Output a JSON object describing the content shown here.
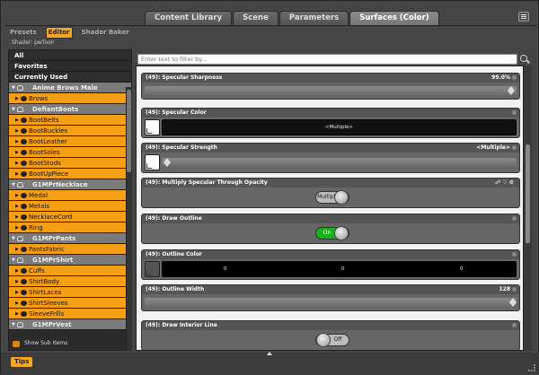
{
  "tabs": [
    "Content Library",
    "Scene",
    "Parameters",
    "Surfaces (Color)"
  ],
  "subtabs": [
    "Presets",
    "Editor",
    "Shader Baker"
  ],
  "shader_label": "Shader: pwToon",
  "left": {
    "top_items": [
      "All",
      "Favorites",
      "Currently Used"
    ],
    "tree": [
      {
        "type": "grp",
        "label": "Anime Brows Male"
      },
      {
        "type": "itm",
        "label": "Brows"
      },
      {
        "type": "grp",
        "label": "DefiantBoots"
      },
      {
        "type": "itm",
        "label": "BootBelts"
      },
      {
        "type": "itm",
        "label": "BootBuckles"
      },
      {
        "type": "itm",
        "label": "BootLeather"
      },
      {
        "type": "itm",
        "label": "BootSoles"
      },
      {
        "type": "itm",
        "label": "BootStuds"
      },
      {
        "type": "itm",
        "label": "BootUpPiece"
      },
      {
        "type": "grp",
        "label": "G1MPrNecklace"
      },
      {
        "type": "itm",
        "label": "Medal"
      },
      {
        "type": "itm",
        "label": "Metals"
      },
      {
        "type": "itm",
        "label": "NecklaceCord"
      },
      {
        "type": "itm",
        "label": "Ring"
      },
      {
        "type": "grp",
        "label": "G1MPrPants"
      },
      {
        "type": "itm",
        "label": "PantsFabric"
      },
      {
        "type": "grp",
        "label": "G1MPrShirt"
      },
      {
        "type": "itm",
        "label": "Cuffs"
      },
      {
        "type": "itm",
        "label": "ShirtBody"
      },
      {
        "type": "itm",
        "label": "ShirtLaces"
      },
      {
        "type": "itm",
        "label": "ShirtSleeves"
      },
      {
        "type": "itm",
        "label": "SleeveFrills"
      },
      {
        "type": "grp",
        "label": "G1MPrVest"
      }
    ],
    "show_sub_items": "Show Sub Items"
  },
  "filter_placeholder": "Enter text to filter by...",
  "props": {
    "spec_sharp": {
      "label": "(49): Specular Sharpness",
      "value": "99.0%",
      "level_percent": 99
    },
    "spec_color": {
      "label": "(49): Specular Color",
      "value": "<Multiple>"
    },
    "spec_strength": {
      "label": "(49): Specular Strength",
      "value": "<Multiple>"
    },
    "mult_spec": {
      "label": "(49): Multiply Specular Through Opacity",
      "toggle": "Multiple"
    },
    "draw_outline": {
      "label": "(49): Draw Outline",
      "toggle": "On"
    },
    "outline_color": {
      "label": "(49): Outline Color",
      "r": "0",
      "g": "0",
      "b": "0"
    },
    "outline_width": {
      "label": "(49): Outline Width",
      "value": "128"
    },
    "draw_interior": {
      "label": "(49): Draw Interior Line",
      "toggle": "Off"
    }
  },
  "tips_label": "Tips",
  "colors": {
    "accent": "#f49f14",
    "toggle_on": "#19b319"
  }
}
